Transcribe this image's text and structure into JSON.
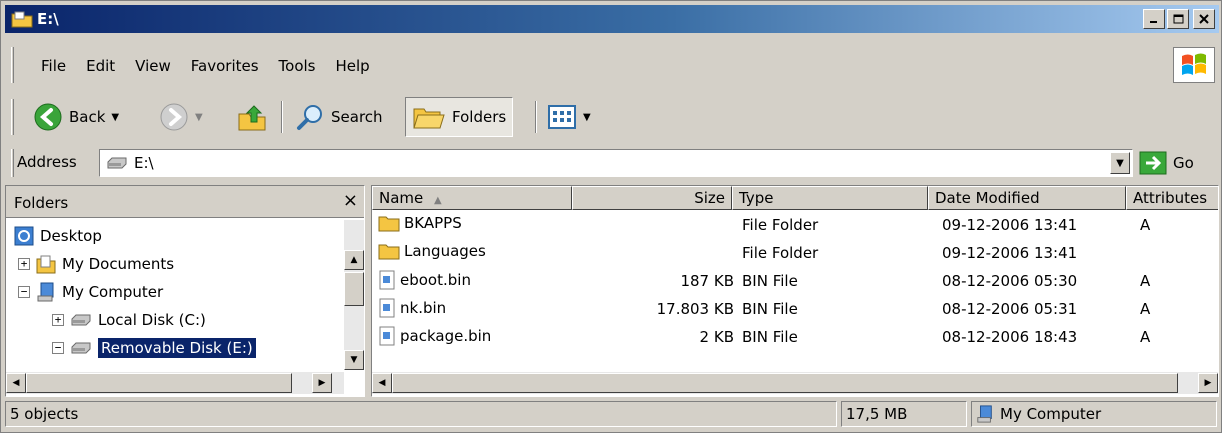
{
  "window": {
    "title": "E:\\"
  },
  "menu": [
    "File",
    "Edit",
    "View",
    "Favorites",
    "Tools",
    "Help"
  ],
  "toolbar": {
    "back_label": "Back",
    "search_label": "Search",
    "folders_label": "Folders"
  },
  "address": {
    "label": "Address",
    "value": "E:\\",
    "go_label": "Go"
  },
  "folders_pane": {
    "title": "Folders",
    "close_glyph": "×",
    "tree": [
      {
        "label": "Desktop"
      },
      {
        "label": "My Documents",
        "expander": "+"
      },
      {
        "label": "My Computer",
        "expander": "−"
      },
      {
        "label": "Local Disk (C:)",
        "expander": "+"
      },
      {
        "label": "Removable Disk (E:)",
        "expander": "−",
        "selected": true
      }
    ]
  },
  "columns": [
    "Name",
    "Size",
    "Type",
    "Date Modified",
    "Attributes"
  ],
  "files": [
    {
      "name": "BKAPPS",
      "size": "",
      "type": "File Folder",
      "date": "09-12-2006 13:41",
      "attr": "A",
      "kind": "folder"
    },
    {
      "name": "Languages",
      "size": "",
      "type": "File Folder",
      "date": "09-12-2006 13:41",
      "attr": "",
      "kind": "folder"
    },
    {
      "name": "eboot.bin",
      "size": "187 KB",
      "type": "BIN File",
      "date": "08-12-2006 05:30",
      "attr": "A",
      "kind": "file"
    },
    {
      "name": "nk.bin",
      "size": "17.803 KB",
      "type": "BIN File",
      "date": "08-12-2006 05:31",
      "attr": "A",
      "kind": "file"
    },
    {
      "name": "package.bin",
      "size": "2 KB",
      "type": "BIN File",
      "date": "08-12-2006 18:43",
      "attr": "A",
      "kind": "file"
    }
  ],
  "status": {
    "objects": "5 objects",
    "size": "17,5 MB",
    "location": "My Computer"
  },
  "icons": {
    "folder": "folder-icon",
    "file": "bin-file-icon",
    "drive": "removable-drive-icon"
  },
  "colors": {
    "title_gradient_start": "#0a246a",
    "title_gradient_end": "#a6caf0",
    "selection": "#0a246a",
    "chrome": "#d4d0c8"
  }
}
